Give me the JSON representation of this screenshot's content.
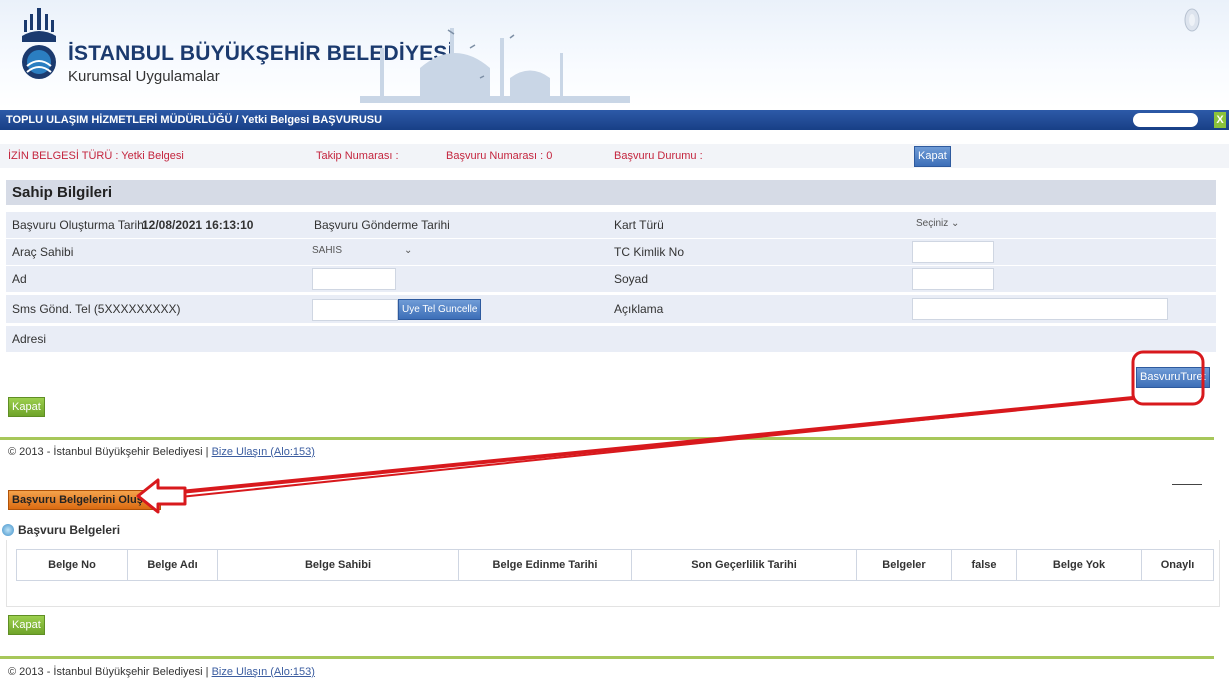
{
  "header": {
    "brand_title": "İSTANBUL BÜYÜKŞEHİR BELEDİYESİ",
    "brand_sub": "Kurumsal Uygulamalar"
  },
  "titlebar": {
    "title": "TOPLU ULAŞIM HİZMETLERİ MÜDÜRLÜĞÜ / Yetki Belgesi BAŞVURUSU",
    "close": "X"
  },
  "info": {
    "izin": "İZİN BELGESİ TÜRÜ : Yetki Belgesi",
    "takip": "Takip Numarası :",
    "basvuru_no": "Başvuru Numarası : 0",
    "durum": "Başvuru Durumu :",
    "kapat": "Kapat"
  },
  "section": {
    "title": "Sahip Bilgileri"
  },
  "form": {
    "olusturma_label": "Başvuru Oluşturma Tarihi",
    "olusturma_value": "12/08/2021 16:13:10",
    "gonderme_label": "Başvuru Gönderme Tarihi",
    "kart_turu_label": "Kart Türü",
    "kart_turu_value": "Seçiniz",
    "arac_sahibi_label": "Araç Sahibi",
    "arac_sahibi_value": "SAHIS",
    "tc_label": "TC Kimlik No",
    "ad_label": "Ad",
    "soyad_label": "Soyad",
    "sms_label": "Sms Gönd. Tel (5XXXXXXXXX)",
    "uye_tel_btn": "Uye Tel Guncelle",
    "aciklama_label": "Açıklama",
    "adres_label": "Adresi"
  },
  "buttons": {
    "basvuru_turet": "BasvuruTuret",
    "kapat_green": "Kapat",
    "belgeleri_olustur": "Başvuru Belgelerini Oluştur"
  },
  "footer": {
    "copyright": "© 2013 - İstanbul Büyükşehir Belediyesi  |",
    "link": "Bize Ulaşın (Alo:153)"
  },
  "docs": {
    "title": "Başvuru Belgeleri",
    "columns": [
      "Belge No",
      "Belge Adı",
      "Belge Sahibi",
      "Belge Edinme Tarihi",
      "Son Geçerlilik Tarihi",
      "Belgeler",
      "false",
      "Belge Yok",
      "Onaylı"
    ]
  }
}
